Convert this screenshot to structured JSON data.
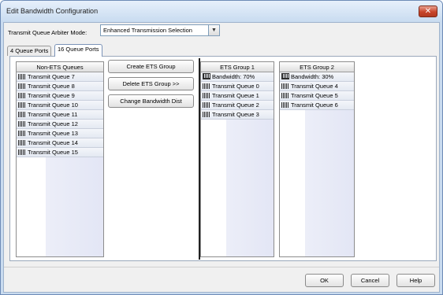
{
  "window": {
    "title": "Edit Bandwidth Configuration",
    "close_glyph": "✕"
  },
  "arbiter": {
    "label": "Transmit Queue Arbiter Mode:",
    "selected": "Enhanced Transmission Selection"
  },
  "tabs": [
    {
      "label": "4 Queue Ports"
    },
    {
      "label": "16 Queue Ports"
    }
  ],
  "non_ets": {
    "header": "Non-ETS Queues",
    "items": [
      "Transmit Queue 7",
      "Transmit Queue 8",
      "Transmit Queue 9",
      "Transmit Queue 10",
      "Transmit Queue 11",
      "Transmit Queue 12",
      "Transmit Queue 13",
      "Transmit Queue 14",
      "Transmit Queue 15"
    ]
  },
  "actions": {
    "create": "Create ETS Group",
    "delete": "Delete ETS Group >>",
    "change": "Change Bandwidth Dist"
  },
  "ets_group_1": {
    "header": "ETS Group 1",
    "bandwidth": "Bandwidth: 70%",
    "items": [
      "Transmit Queue 0",
      "Transmit Queue 1",
      "Transmit Queue 2",
      "Transmit Queue 3"
    ]
  },
  "ets_group_2": {
    "header": "ETS Group 2",
    "bandwidth": "Bandwidth: 30%",
    "items": [
      "Transmit Queue 4",
      "Transmit Queue 5",
      "Transmit Queue 6"
    ]
  },
  "buttons": {
    "ok": "OK",
    "cancel": "Cancel",
    "help": "Help"
  },
  "icons": {
    "queue": "queue-icon",
    "bandwidth": "bandwidth-icon",
    "dropdown": "chevron-down-icon",
    "close": "close-icon"
  }
}
